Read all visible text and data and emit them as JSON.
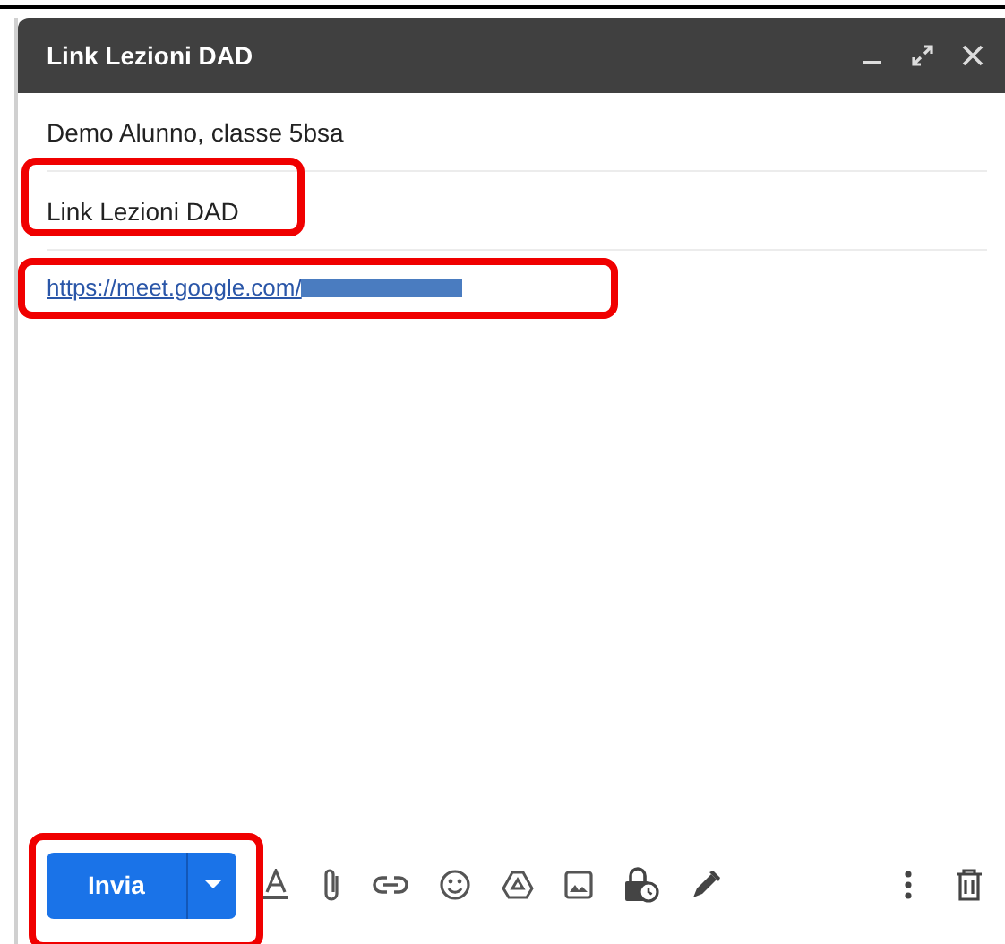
{
  "window": {
    "title": "Link Lezioni DAD"
  },
  "recipients": {
    "value": "Demo Alunno, classe 5bsa"
  },
  "subject": {
    "value": "Link Lezioni DAD",
    "highlighted": true
  },
  "body": {
    "link": "https://meet.google.com/",
    "redacted": true,
    "highlighted": true
  },
  "send_button": {
    "label": "Invia",
    "highlighted": true
  }
}
